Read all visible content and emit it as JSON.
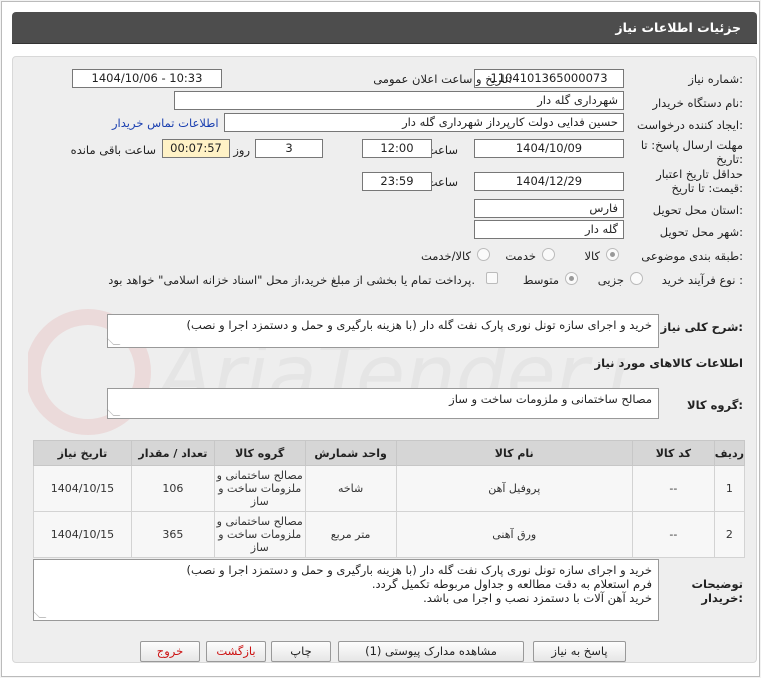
{
  "header": {
    "title": "جزئیات اطلاعات نیاز"
  },
  "form": {
    "need_number_label": "شماره نیاز:",
    "need_number": "1104101365000073",
    "announce_label": "تاریخ و ساعت اعلان عمومی:",
    "announce_value": "1404/10/06 - 10:33",
    "buyer_org_label": "نام دستگاه خریدار:",
    "buyer_org": "شهرداری گله دار",
    "requester_label": "ایجاد کننده درخواست:",
    "requester": "حسین فدایی دولت کارپرداز شهرداری گله دار",
    "contact_link": "اطلاعات تماس خریدار",
    "reply_label_1": "مهلت ارسال پاسخ: تا",
    "reply_label_2": "تاریخ:",
    "reply_date": "1404/10/09",
    "time_label": "ساعت",
    "reply_time": "12:00",
    "days": "3",
    "days_label": "روز و",
    "remaining": "00:07:57",
    "remaining_label": "ساعت باقی مانده",
    "price_label_1": "حداقل تاریخ اعتبار",
    "price_label_2": "قیمت: تا تاریخ:",
    "price_date": "1404/12/29",
    "price_time": "23:59",
    "province_label": "استان محل تحویل:",
    "province": "فارس",
    "city_label": "شهر محل تحویل:",
    "city": "گله دار",
    "category_label": "طبقه بندی موضوعی:",
    "cat_goods": "کالا",
    "cat_service": "خدمت",
    "cat_both": "کالا/خدمت",
    "purchase_type_label": "نوع فرآیند خرید :",
    "pt_partial": "جزیی",
    "pt_medium": "متوسط",
    "treasury_note": "پرداخت تمام یا بخشی از مبلغ خرید،از محل \"اسناد خزانه اسلامی\" خواهد بود.",
    "desc_label": "شرح کلی نیاز:",
    "description": "خرید و اجرای سازه تونل نوری پارک نفت گله دار (با هزینه بارگیری و حمل و دستمزد اجرا و نصب)"
  },
  "goods": {
    "section_title": "اطلاعات کالاهای مورد نیاز",
    "group_label": "گروه کالا:",
    "group": "مصالح ساختمانی و ملزومات ساخت و ساز",
    "columns": [
      "ردیف",
      "کد کالا",
      "نام کالا",
      "واحد شمارش",
      "گروه کالا",
      "تعداد / مقدار",
      "تاریخ نیاز"
    ],
    "rows": [
      {
        "idx": "1",
        "code": "--",
        "name": "پروفیل آهن",
        "unit": "شاخه",
        "group": "مصالح ساختمانی و ملزومات ساخت و ساز",
        "qty": "106",
        "date": "1404/10/15"
      },
      {
        "idx": "2",
        "code": "--",
        "name": "ورق آهنی",
        "unit": "متر مربع",
        "group": "مصالح ساختمانی و ملزومات ساخت و ساز",
        "qty": "365",
        "date": "1404/10/15"
      }
    ]
  },
  "notes": {
    "label_1": "توضیحات",
    "label_2": "خریدار:",
    "lines": [
      "خرید و اجرای سازه تونل نوری پارک نفت گله دار (با هزینه بارگیری و حمل و دستمزد اجرا و نصب)",
      "فرم استعلام به دقت مطالعه و جداول مربوطه تکمیل گردد.",
      "خرید آهن آلات با دستمزد نصب و اجرا می باشد."
    ]
  },
  "buttons": {
    "reply": "پاسخ به نیاز",
    "attachments": "مشاهده مدارک پیوستی (1)",
    "print": "چاپ",
    "back": "بازگشت",
    "exit": "خروج"
  },
  "colors": {
    "header_bg": "#4d4d4d",
    "link": "#1a3fb0",
    "remaining_bg": "#fff2c6",
    "danger_text": "#cc1111"
  }
}
